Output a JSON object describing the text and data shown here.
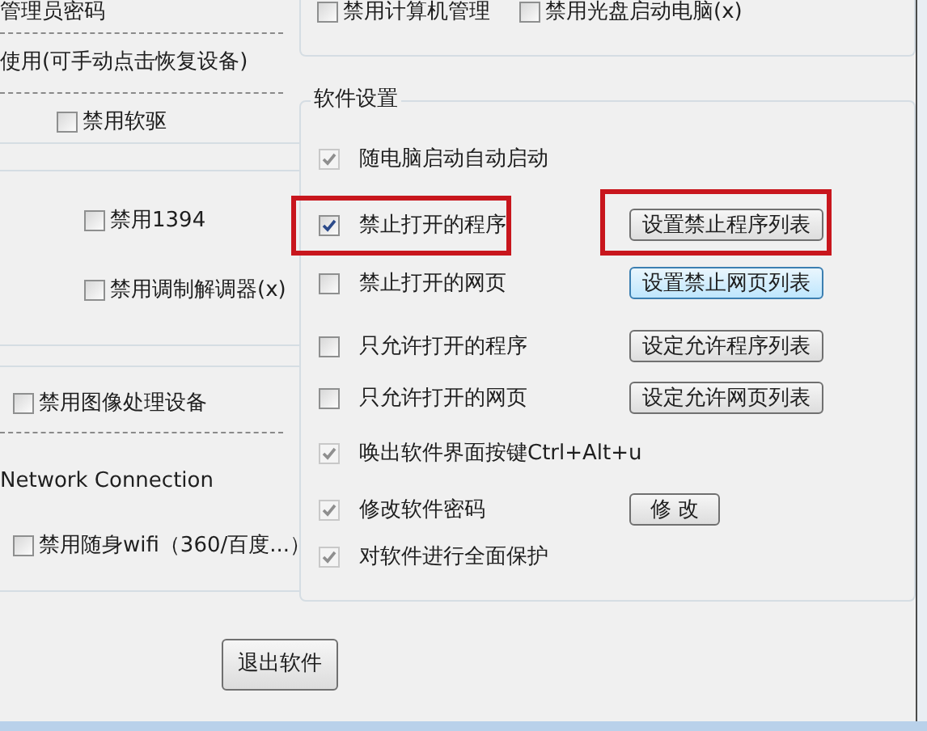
{
  "left_panel": {
    "items": [
      {
        "kind": "note",
        "text": "管理员密码"
      },
      {
        "kind": "note",
        "text": "使用(可手动点击恢复设备)"
      },
      {
        "kind": "checkbox",
        "label": "禁用软驱",
        "checked": false
      },
      {
        "kind": "checkbox",
        "label": "禁用1394",
        "checked": false
      },
      {
        "kind": "checkbox",
        "label": "禁用调制解调器(x)",
        "checked": false
      },
      {
        "kind": "checkbox",
        "label": "禁用图像处理设备",
        "checked": false
      },
      {
        "kind": "note",
        "text": "Network Connection"
      },
      {
        "kind": "checkbox",
        "label": "禁用随身wifi（360/百度...）",
        "checked": false
      }
    ]
  },
  "top_group": {
    "checkboxes": [
      {
        "label": "禁用计算机管理",
        "checked": false
      },
      {
        "label": "禁用光盘启动电脑(x)",
        "checked": false
      }
    ]
  },
  "software_settings": {
    "title": "软件设置",
    "rows": [
      {
        "label": "随电脑启动自动启动",
        "checked": true,
        "disabled": true,
        "highlighted": false
      },
      {
        "label": "禁止打开的程序",
        "checked": true,
        "disabled": false,
        "highlighted": true,
        "button": {
          "label": "设置禁止程序列表",
          "hovered": false,
          "highlighted": true
        }
      },
      {
        "label": "禁止打开的网页",
        "checked": false,
        "disabled": false,
        "highlighted": false,
        "button": {
          "label": "设置禁止网页列表",
          "hovered": true,
          "highlighted": false
        }
      },
      {
        "label": "只允许打开的程序",
        "checked": false,
        "disabled": false,
        "highlighted": false,
        "button": {
          "label": "设定允许程序列表",
          "hovered": false,
          "highlighted": false
        }
      },
      {
        "label": "只允许打开的网页",
        "checked": false,
        "disabled": false,
        "highlighted": false,
        "button": {
          "label": "设定允许网页列表",
          "hovered": false,
          "highlighted": false
        }
      },
      {
        "label": "唤出软件界面按键Ctrl+Alt+u",
        "checked": true,
        "disabled": true,
        "highlighted": false
      },
      {
        "label": "修改软件密码",
        "checked": true,
        "disabled": true,
        "highlighted": false,
        "button": {
          "label": "修 改",
          "hovered": false,
          "highlighted": false
        }
      },
      {
        "label": "对软件进行全面保护",
        "checked": true,
        "disabled": true,
        "highlighted": false
      }
    ]
  },
  "exit_button": {
    "label": "退出软件"
  }
}
